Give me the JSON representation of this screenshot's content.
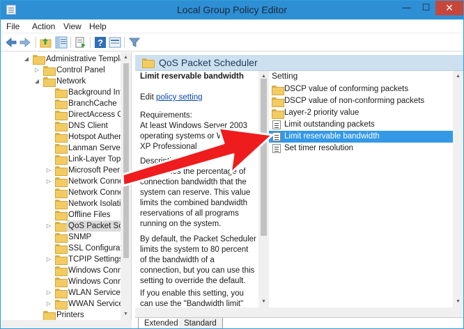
{
  "window": {
    "title": "Local Group Policy Editor",
    "close_glyph": "✕",
    "min_glyph": "—",
    "max_glyph": "☐"
  },
  "menu": [
    "File",
    "Action",
    "View",
    "Help"
  ],
  "tree": [
    {
      "label": "Administrative Templat",
      "exp": "◢",
      "level": 0
    },
    {
      "label": "Control Panel",
      "exp": "▷",
      "level": 1
    },
    {
      "label": "Network",
      "exp": "◢",
      "level": 1
    },
    {
      "label": "Background Inte",
      "exp": "",
      "level": 2
    },
    {
      "label": "BranchCache",
      "exp": "",
      "level": 2
    },
    {
      "label": "DirectAccess Clie",
      "exp": "",
      "level": 2
    },
    {
      "label": "DNS Client",
      "exp": "",
      "level": 2
    },
    {
      "label": "Hotspot Authent",
      "exp": "",
      "level": 2
    },
    {
      "label": "Lanman Server",
      "exp": "",
      "level": 2
    },
    {
      "label": "Link-Layer Topo",
      "exp": "",
      "level": 2
    },
    {
      "label": "Microsoft Peer-t",
      "exp": "▷",
      "level": 2
    },
    {
      "label": "Network Connec",
      "exp": "▷",
      "level": 2
    },
    {
      "label": "Network Connect",
      "exp": "",
      "level": 2
    },
    {
      "label": "Network Isolatio",
      "exp": "",
      "level": 2
    },
    {
      "label": "Offline Files",
      "exp": "",
      "level": 2
    },
    {
      "label": "QoS Packet Sche",
      "exp": "▷",
      "level": 2,
      "selected": true
    },
    {
      "label": "SNMP",
      "exp": "",
      "level": 2
    },
    {
      "label": "SSL Configuratio",
      "exp": "",
      "level": 2
    },
    {
      "label": "TCPIP Settings",
      "exp": "▷",
      "level": 2
    },
    {
      "label": "Windows Conne",
      "exp": "",
      "level": 2
    },
    {
      "label": "Windows Conne",
      "exp": "",
      "level": 2
    },
    {
      "label": "WLAN Service",
      "exp": "▷",
      "level": 2
    },
    {
      "label": "WWAN Service",
      "exp": "▷",
      "level": 2
    },
    {
      "label": "Printers",
      "exp": "",
      "level": 1
    }
  ],
  "pane": {
    "header": "QoS Packet Scheduler"
  },
  "description": {
    "title": "Limit reservable bandwidth",
    "edit_prefix": "Edit ",
    "edit_link": "policy setting",
    "requirements_label": "Requirements:",
    "requirements": "At least Windows Server 2003 operating systems or Windows XP Professional",
    "description_label": "Description:",
    "description": "Determines the percentage of connection bandwidth that the system can reserve. This value limits the combined bandwidth reservations of all programs running on the system.",
    "default_text": "By default, the Packet Scheduler limits the system to 80 percent of the bandwidth of a connection, but you can use this setting to override the default.",
    "enable_text": "If you enable this setting, you can use the \"Bandwidth limit\" box to adjust the amount of bandwidth"
  },
  "settings": {
    "column_header": "Setting",
    "items": [
      {
        "label": "DSCP value of conforming packets",
        "icon": "folder"
      },
      {
        "label": "DSCP value of non-conforming packets",
        "icon": "folder"
      },
      {
        "label": "Layer-2 priority value",
        "icon": "folder"
      },
      {
        "label": "Limit outstanding packets",
        "icon": "setting"
      },
      {
        "label": "Limit reservable bandwidth",
        "icon": "setting",
        "selected": true
      },
      {
        "label": "Set timer resolution",
        "icon": "setting"
      }
    ]
  },
  "tabs": [
    "Extended",
    "Standard"
  ],
  "colors": {
    "titlebar": "#2e8fd4",
    "selection": "#3399e6",
    "arrow": "#ee1c1c",
    "close": "#c7463b"
  }
}
